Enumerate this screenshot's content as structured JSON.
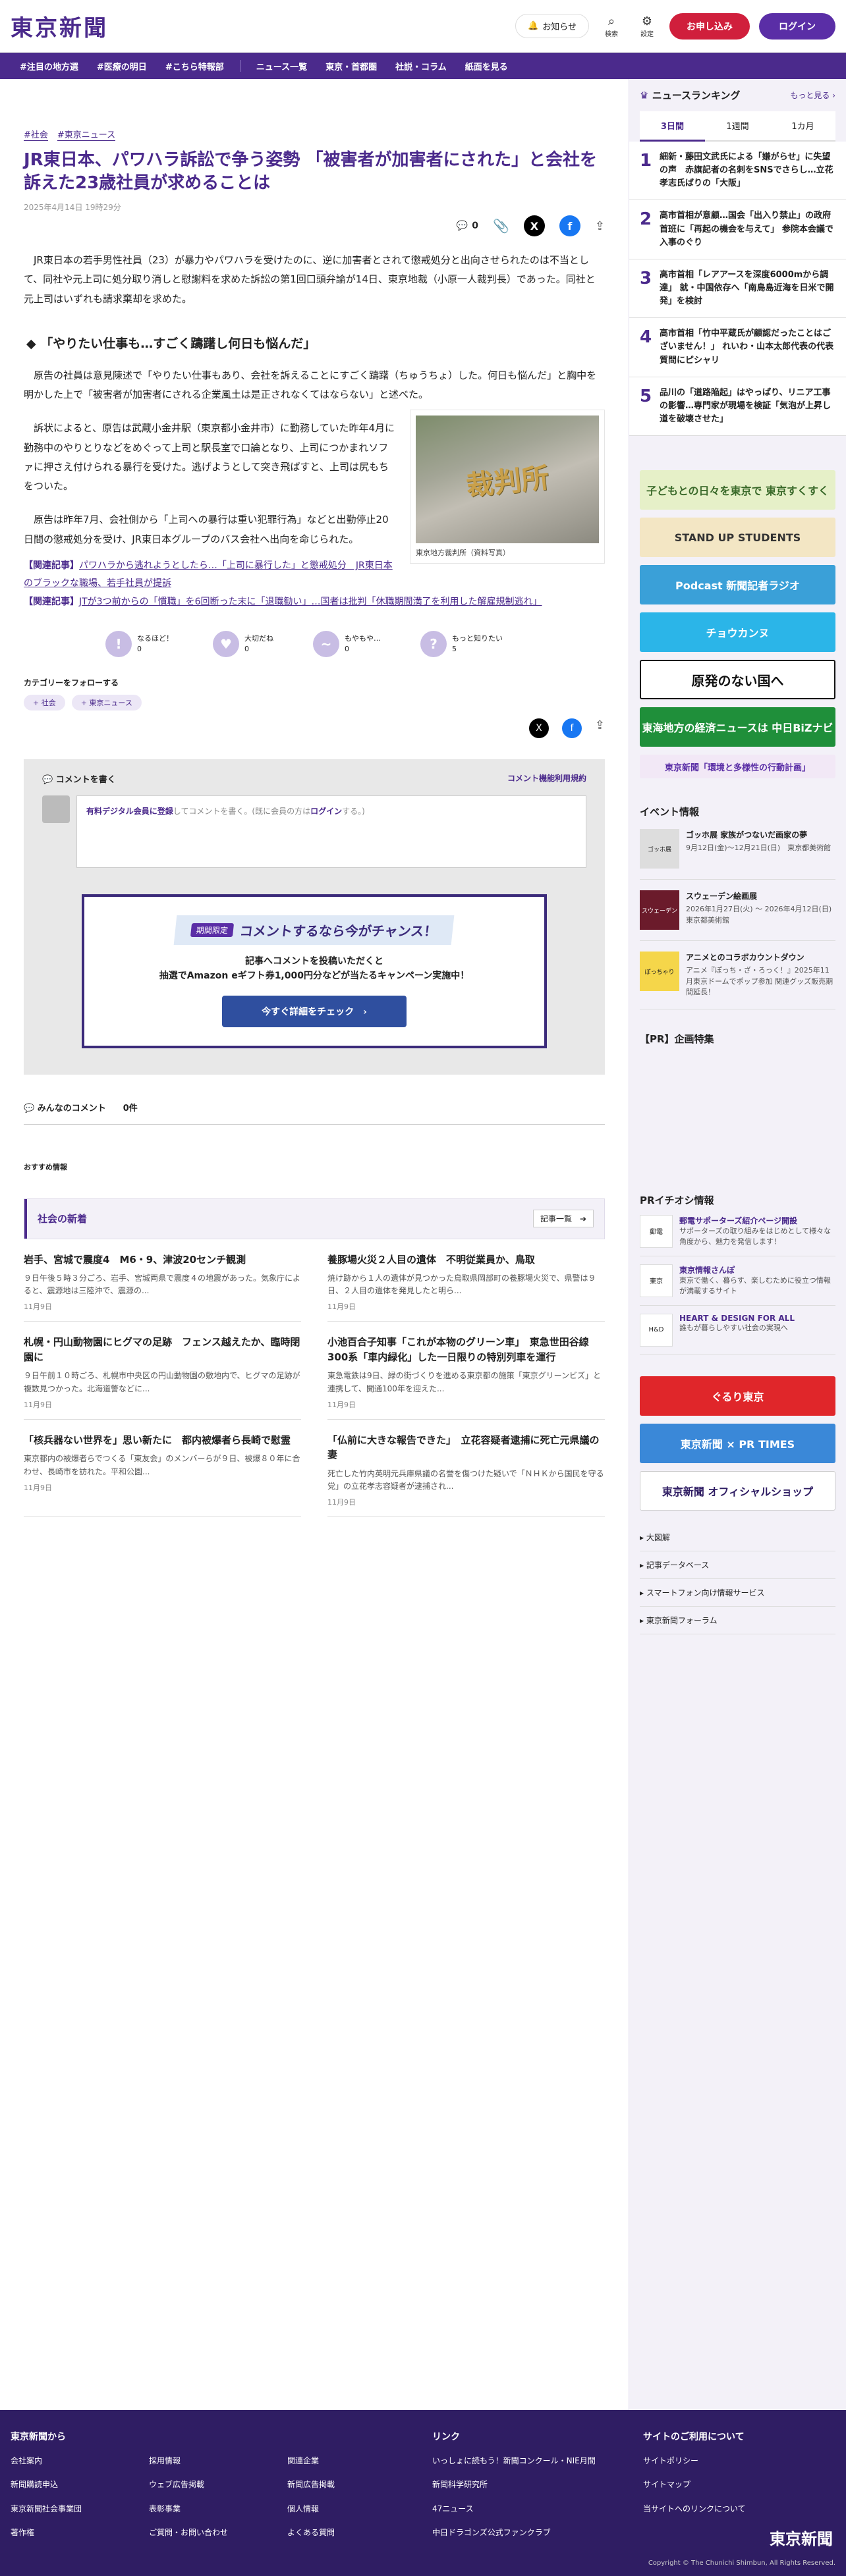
{
  "header": {
    "logo": "東京新聞",
    "notice": "お知らせ",
    "search": "検索",
    "settings": "設定",
    "apply": "お申し込み",
    "login": "ログイン"
  },
  "nav": [
    "#注目の地方選",
    "#医療の明日",
    "#こちら特報部",
    "ニュース一覧",
    "東京・首都圏",
    "社説・コラム",
    "紙面を見る"
  ],
  "article": {
    "tags": [
      "#社会",
      "#東京ニュース"
    ],
    "title": "JR東日本、パワハラ訴訟で争う姿勢 「被害者が加害者にされた」と会社を訴えた23歳社員が求めることは",
    "date": "2025年4月14日 19時29分",
    "comments_count": "0",
    "p1": "JR東日本の若手男性社員（23）が暴力やパワハラを受けたのに、逆に加害者とされて懲戒処分と出向させられたのは不当として、同社や元上司に処分取り消しと慰謝料を求めた訴訟の第1回口頭弁論が14日、東京地裁（小原一人裁判長）であった。同社と元上司はいずれも請求棄却を求めた。",
    "h2": "「やりたい仕事も…すごく躊躇し何日も悩んだ」",
    "p2": "原告の社員は意見陳述で「やりたい仕事もあり、会社を訴えることにすごく躊躇（ちゅうちょ）した。何日も悩んだ」と胸中を明かした上で「被害者が加害者にされる企業風土は是正されなくてはならない」と述べた。",
    "p3": "訴状によると、原告は武蔵小金井駅（東京都小金井市）に勤務していた昨年4月に勤務中のやりとりなどをめぐって上司と駅長室で口論となり、上司につかまれソファに押さえ付けられる暴行を受けた。逃げようとして突き飛ばすと、上司は尻もちをついた。",
    "p4": "原告は昨年7月、会社側から「上司への暴行は重い犯罪行為」などと出勤停止20日間の懲戒処分を受け、JR東日本グループのバス会社へ出向を命じられた。",
    "photo_text": "裁判所",
    "caption": "東京地方裁判所（資料写真）",
    "rel_label": "【関連記事】",
    "rel1": "パワハラから逃れようとしたら…「上司に暴行した」と懲戒処分　JR東日本のブラックな職場、若手社員が提訴",
    "rel2": "JTが3つ前からの「慣職」を6回断った末に「退職勧い」…国者は批判「休職期間満了を利用した解雇規制逃れ」"
  },
  "reactions": [
    {
      "icon": "!",
      "label": "なるほど！",
      "count": "0"
    },
    {
      "icon": "♥",
      "label": "大切だね",
      "count": "0"
    },
    {
      "icon": "~",
      "label": "もやもや…",
      "count": "0"
    },
    {
      "icon": "?",
      "label": "もっと知りたい",
      "count": "5"
    }
  ],
  "follow": {
    "title": "カテゴリーをフォローする",
    "chips": [
      "+ 社会",
      "+ 東京ニュース"
    ]
  },
  "comment": {
    "write": "コメントを書く",
    "rules": "コメント機能利用規約",
    "ph_pre": "有料デジタル会員に登録",
    "ph_mid": "してコメントを書く。(既に会員の方は",
    "ph_login": "ログイン",
    "ph_post": "する。)",
    "camp_tag": "期間限定",
    "camp_title": "コメントするなら今がチャンス！",
    "camp_l1": "記事へコメントを投稿いただくと",
    "camp_l2": "抽選でAmazon eギフト券1,000円分などが当たるキャンペーン実施中！",
    "camp_btn": "今すぐ詳細をチェック　›",
    "all": "みんなのコメント　　0件"
  },
  "reco": "おすすめ情報",
  "social_news": {
    "title": "社会の新着",
    "more": "記事一覧　➔",
    "items": [
      {
        "t": "岩手、宮城で震度4　M6・9、津波20センチ観測",
        "s": "９日午後５時３分ごろ、岩手、宮城両県で震度４の地震があった。気象庁によると、震源地は三陸沖で、震源の...",
        "d": "11月9日"
      },
      {
        "t": "養豚場火災２人目の遺体　不明従業員か、鳥取",
        "s": "焼け跡から１人の遺体が見つかった鳥取県岡部町の養豚場火災で、県警は９日、２人目の遺体を発見したと明ら...",
        "d": "11月9日"
      },
      {
        "t": "札幌・円山動物園にヒグマの足跡　フェンス越えたか、臨時閉園に",
        "s": "９日午前１０時ごろ、札幌市中央区の円山動物園の敷地内で、ヒグマの足跡が複数見つかった。北海道警などに...",
        "d": "11月9日"
      },
      {
        "t": "小池百合子知事「これが本物のグリーン車」　東急世田谷線300系「車内緑化」した一日限りの特別列車を運行",
        "s": "東急電鉄は9日、緑の街づくりを進める東京都の施策「東京グリーンビズ」と連携して、開通100年を迎えた...",
        "d": "11月9日"
      },
      {
        "t": "「核兵器ない世界を」思い新たに　都内被爆者ら長崎で慰霊",
        "s": "東京都内の被爆者らでつくる「東友会」のメンバーらが９日、被爆８０年に合わせ、長崎市を訪れた。平和公園...",
        "d": "11月9日"
      },
      {
        "t": "「仏前に大きな報告できた」　立花容疑者逮捕に死亡元県議の妻",
        "s": "死亡した竹内英明元兵庫県議の名誉を傷つけた疑いで「ＮＨＫから国民を守る党」の立花孝志容疑者が逮捕され...",
        "d": "11月9日"
      }
    ]
  },
  "side": {
    "rank_title": "ニュースランキング",
    "rank_more": "もっと見る ›",
    "tabs": [
      "3日間",
      "1週間",
      "1カ月"
    ],
    "ranks": [
      {
        "n": "1",
        "t": "細新・藤田文武氏による「嫌がらせ」に失望の声　赤旗記者の名刺をSNSでさらし…立花孝志氏ばりの「大阪」"
      },
      {
        "n": "2",
        "t": "高市首相が意顧…国会「出入り禁止」の政府首班に「再起の機会を与えて」 参院本会議で入事のぐり"
      },
      {
        "n": "3",
        "t": "高市首相「レアアースを深度6000mから調達」 就・中国依存へ「南鳥島近海を日米で開発」を検討"
      },
      {
        "n": "4",
        "t": "高市首相「竹中平蔵氏が顧認だったことはございません！」 れいわ・山本太郎代表の代表質問にピシャリ"
      },
      {
        "n": "5",
        "t": "品川の「道路陥起」はやっぱり、リニア工事の影響…専門家が現場を検証「気泡が上昇し道を破壊させた」"
      }
    ],
    "banners": [
      {
        "t": "子どもとの日々を東京で 東京すくすく",
        "c": "#e6f0c8",
        "f": "#3a6a2a"
      },
      {
        "t": "STAND UP STUDENTS",
        "c": "#f3e6c4",
        "f": "#333"
      },
      {
        "t": "Podcast 新聞記者ラジオ",
        "c": "#3aa0d8",
        "f": "#fff"
      },
      {
        "t": "チョウカンヌ",
        "c": "#2bb5e8",
        "f": "#fff"
      },
      {
        "t": "原発のない国へ",
        "c": "#ffffff",
        "f": "#111"
      },
      {
        "t": "東海地方の経済ニュースは 中日BiZナビ",
        "c": "#1f8f3a",
        "f": "#fff"
      },
      {
        "t": "東京新聞「環境と多様性の行動計画」",
        "c": "#f2e8f6",
        "f": "#5a2ea6"
      }
    ],
    "ev_title": "イベント情報",
    "events": [
      {
        "th": "ゴッホ展",
        "t": "ゴッホ展 家族がつないだ画家の夢",
        "d": "9月12日(金)〜12月21日(日)　東京都美術館"
      },
      {
        "th": "スウェーデン",
        "t": "スウェーデン絵画展",
        "d": "2026年1月27日(火) 〜 2026年4月12日(日)　東京都美術館"
      },
      {
        "th": "ぽっちゃり",
        "t": "アニメとのコラボカウントダウン",
        "d": "アニメ『ぽっち・ざ・ろっく！』2025年11月東京ドームでポップ参加 関連グッズ販売期間延長！"
      }
    ],
    "pr_plan": "【PR】企画特集",
    "pr_title": "PRイチオシ情報",
    "pr_items": [
      {
        "th": "郵電",
        "t": "郵電サポーターズ紹介ページ開設",
        "d": "サポーターズの取り組みをはじめとして様々な角度から、魅力を発信します！"
      },
      {
        "th": "東京",
        "t": "東京情報さんぽ",
        "d": "東京で働く、暮らす、楽しむために役立つ情報が満載するサイト"
      },
      {
        "th": "H&D",
        "t": "HEART & DESIGN FOR ALL",
        "d": "誰もが暮らしやすい社会の実現へ"
      }
    ],
    "banners2": [
      {
        "t": "ぐるり東京",
        "c": "#e0262a",
        "f": "#fff"
      },
      {
        "t": "東京新聞 × PR TIMES",
        "c": "#3a88d8",
        "f": "#fff"
      },
      {
        "t": "東京新聞 オフィシャルショップ",
        "c": "#ffffff",
        "f": "#2f1d63"
      }
    ],
    "links": [
      "大図解",
      "記事データベース",
      "スマートフォン向け情報サービス",
      "東京新聞フォーラム"
    ]
  },
  "footer": {
    "col1": "東京新聞から",
    "col1_links": [
      "会社案内",
      "新聞購読申込",
      "東京新聞社会事業団",
      "著作権",
      "採用情報",
      "ウェブ広告掲載",
      "表彰事業",
      "ご質問・お問い合わせ",
      "関連企業",
      "新聞広告掲載",
      "個人情報",
      "よくある質問"
    ],
    "col2": "リンク",
    "col2_links": [
      "いっしょに読もう！新聞コンクール・NIE月間",
      "新聞科学研究所",
      "47ニュース",
      "中日ドラゴンズ公式ファンクラブ"
    ],
    "col3": "サイトのご利用について",
    "col3_links": [
      "サイトポリシー",
      "サイトマップ",
      "当サイトへのリンクについて"
    ],
    "logo": "東京新聞",
    "copy": "Copyright © The Chunichi Shimbun, All Rights Reserved."
  }
}
